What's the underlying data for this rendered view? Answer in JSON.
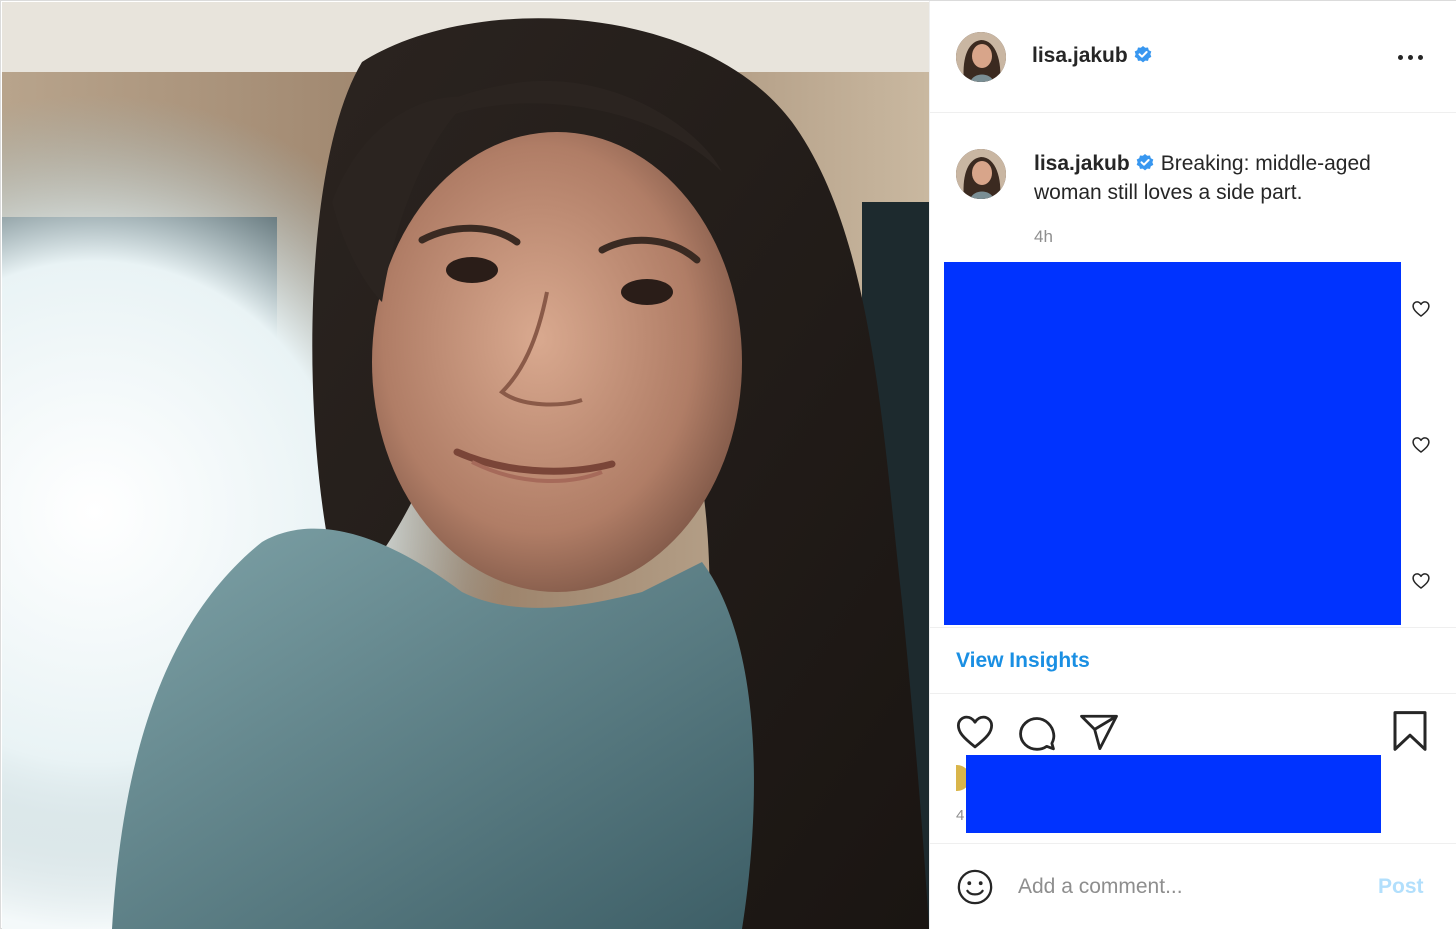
{
  "post": {
    "username": "lisa.jakub",
    "caption": "Breaking: middle-aged woman still loves a side part.",
    "time_ago": "4h"
  },
  "actions": {
    "view_insights": "View Insights",
    "likes_partial": "4"
  },
  "comment_bar": {
    "placeholder": "Add a comment...",
    "post_label": "Post"
  },
  "icons": {
    "more": "more-options-icon",
    "verified": "verified-badge-icon",
    "like": "heart-icon",
    "comment": "comment-bubble-icon",
    "share": "paper-plane-icon",
    "save": "bookmark-icon",
    "emoji": "smiley-icon"
  },
  "colors": {
    "link_blue": "#1a8fe3",
    "post_button_disabled": "#b2dffc",
    "verified_blue": "#3897f0",
    "redaction_blue": "#0033ff",
    "muted_text": "#8e8e8e"
  }
}
